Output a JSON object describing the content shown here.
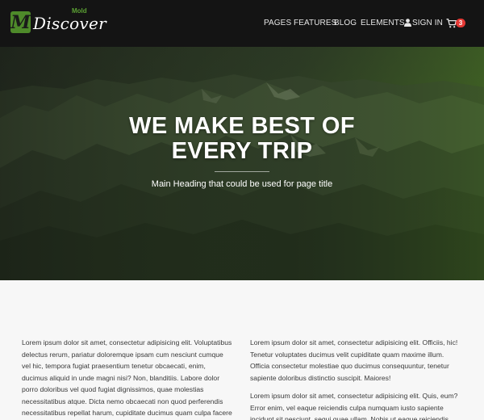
{
  "header": {
    "logo_letter": "M",
    "logo_text": "Discover",
    "logo_sub": "Mold",
    "nav": {
      "pages": "PAGES",
      "features": "FEATURES",
      "blog": "BLOG",
      "elements": "ELEMENTS",
      "sign_in": "SIGN IN",
      "cart_count": "3"
    }
  },
  "hero": {
    "title_line1": "WE MAKE BEST OF",
    "title_line2": "EVERY TRIP",
    "subtitle": "Main Heading that could be used for page title"
  },
  "content": {
    "left": [
      "Lorem ipsum dolor sit amet, consectetur adipisicing elit. Voluptatibus delectus rerum, pariatur doloremque ipsam cum nesciunt cumque vel hic, tempora fugiat praesentium tenetur obcaecati, enim, ducimus aliquid in unde magni nisi? Non, blanditiis. Labore dolor porro doloribus vel quod fugiat dignissimos, quae molestias necessitatibus atque. Dicta nemo obcaecati non quod perferendis necessitatibus repellat harum, cupiditate ducimus quam culpa facere beatae!"
    ],
    "right": [
      "Lorem ipsum dolor sit amet, consectetur adipisicing elit. Officiis, hic! Tenetur voluptates ducimus velit cupiditate quam maxime illum. Officia consectetur molestiae quo ducimus consequuntur, tenetur sapiente doloribus distinctio suscipit. Maiores!",
      "Lorem ipsum dolor sit amet, consectetur adipisicing elit. Quis, eum? Error enim, vel eaque reiciendis culpa numquam iusto sapiente incidunt sit nesciunt, sequi quae ullam. Nobis ut eaque reiciendis"
    ]
  },
  "colors": {
    "header_bg": "#141414",
    "brand_green": "#4e8a2a",
    "badge_red": "#e53935",
    "page_bg": "#f7f7f7"
  },
  "icons": {
    "sign_in": "user-icon",
    "cart": "shopping-cart-icon"
  }
}
